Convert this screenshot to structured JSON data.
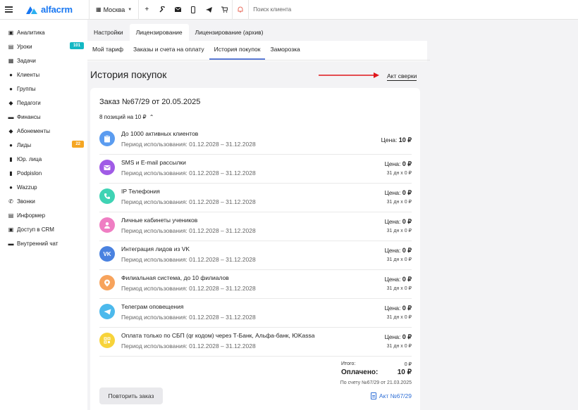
{
  "topbar": {
    "logo": "alfacrm",
    "city": "Москва",
    "search_placeholder": "Поиск клиента",
    "icons": [
      "plus-icon",
      "wrench-icon",
      "mail-icon",
      "phone-icon",
      "telegram-icon",
      "cart-icon",
      "bell-icon"
    ]
  },
  "sidebar": {
    "items": [
      {
        "label": "Аналитика",
        "icon": "briefcase-icon"
      },
      {
        "label": "Уроки",
        "icon": "book-icon",
        "badge": "101"
      },
      {
        "label": "Задачи",
        "icon": "calendar-icon"
      },
      {
        "label": "Клиенты",
        "icon": "user-icon"
      },
      {
        "label": "Группы",
        "icon": "group-icon"
      },
      {
        "label": "Педагоги",
        "icon": "graduation-icon"
      },
      {
        "label": "Финансы",
        "icon": "money-icon"
      },
      {
        "label": "Абонементы",
        "icon": "tag-icon"
      },
      {
        "label": "Лиды",
        "icon": "leads-icon",
        "badge": "22"
      },
      {
        "label": "Юр. лица",
        "icon": "building-icon"
      },
      {
        "label": "Podpislon",
        "icon": "document-icon"
      },
      {
        "label": "Wazzup",
        "icon": "whatsapp-icon"
      },
      {
        "label": "Звонки",
        "icon": "phone-icon"
      },
      {
        "label": "Информер",
        "icon": "informer-icon"
      },
      {
        "label": "Доступ в CRM",
        "icon": "lock-icon"
      },
      {
        "label": "Внутренний чат",
        "icon": "chat-icon"
      }
    ]
  },
  "tabs_top": [
    "Настройки",
    "Лицензирование",
    "Лицензирование (архив)"
  ],
  "tabs_sub": [
    "Мой тариф",
    "Заказы и счета на оплату",
    "История покупок",
    "Заморозка"
  ],
  "page": {
    "title": "История покупок",
    "akt_link": "Акт сверки"
  },
  "order": {
    "title_number": "Заказ №67/29",
    "title_date": "от 20.05.2025",
    "positions": "8 позиций на 10 ₽",
    "period_prefix": "Период использования: ",
    "price_label": "Цена:",
    "items": [
      {
        "name": "До 1000 активных клиентов",
        "period": "Период использования: 01.12.2028 – 31.12.2028",
        "price": "10 ₽",
        "days": "",
        "color": "#5b9cf0",
        "icon": "clipboard-icon"
      },
      {
        "name": "SMS и E-mail рассылки",
        "period": "Период использования: 01.12.2028 – 31.12.2028",
        "price": "0 ₽",
        "days": "31 дн x 0 ₽",
        "color": "#a05be6",
        "icon": "mail-icon"
      },
      {
        "name": "IP Телефония",
        "period": "Период использования: 01.12.2028 – 31.12.2028",
        "price": "0 ₽",
        "days": "31 дн x 0 ₽",
        "color": "#3fd3b4",
        "icon": "phone-icon"
      },
      {
        "name": "Личные кабинеты учеников",
        "period": "Период использования: 01.12.2028 – 31.12.2028",
        "price": "0 ₽",
        "days": "31 дн x 0 ₽",
        "color": "#ef7ec3",
        "icon": "user-icon"
      },
      {
        "name": "Интеграция лидов из VK",
        "period": "Период использования: 01.12.2028 – 31.12.2028",
        "price": "0 ₽",
        "days": "31 дн x 0 ₽",
        "color": "#4a82e0",
        "icon": "vk-icon"
      },
      {
        "name": "Филиальная система, до 10 филиалов",
        "period": "Период использования: 01.12.2028 – 31.12.2028",
        "price": "0 ₽",
        "days": "31 дн x 0 ₽",
        "color": "#f7a35c",
        "icon": "branch-icon"
      },
      {
        "name": "Телеграм оповещения",
        "period": "Период использования: 01.12.2028 – 31.12.2028",
        "price": "0 ₽",
        "days": "31 дн x 0 ₽",
        "color": "#4cb9ec",
        "icon": "telegram-icon"
      },
      {
        "name": "Оплата только по СБП (qr кодом) через Т-Банк, Альфа-банк, ЮKassa",
        "period": "Период использования: 01.12.2028 – 31.12.2028",
        "price": "0 ₽",
        "days": "31 дн x 0 ₽",
        "color": "#f7d33a",
        "icon": "qr-icon"
      }
    ],
    "totals": {
      "itogo_label": "Итого:",
      "itogo_value": "0 ₽",
      "paid_label": "Оплачено:",
      "paid_value": "10 ₽",
      "invoice_note": "По счету №67/29 от 21.03.2025"
    },
    "repeat_button": "Повторить заказ",
    "akt_doc": "Акт №67/29"
  },
  "colors": {
    "accent": "#1877f2",
    "arrow": "#e0161b",
    "tab_underline": "#5b7bd5",
    "link": "#2f6fd6"
  }
}
